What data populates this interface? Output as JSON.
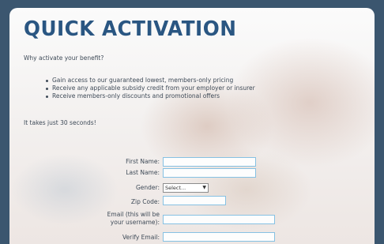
{
  "title": "QUICK ACTIVATION",
  "lead": "Why activate your benefit?",
  "bullets": [
    "Gain access to our guaranteed lowest, members-only pricing",
    "Receive any applicable subsidy credit from your employer or insurer",
    "Receive members-only discounts and promotional offers"
  ],
  "seconds": "It takes just 30 seconds!",
  "form": {
    "first_name_label": "First Name:",
    "last_name_label": "Last Name:",
    "gender_label": "Gender:",
    "gender_value": "Select...",
    "zip_label": "Zip Code:",
    "email_label_line1": "Email (this will be",
    "email_label_line2": "your username):",
    "verify_email_label": "Verify Email:"
  },
  "icons": {
    "select_arrow": "chevron-down-icon"
  }
}
